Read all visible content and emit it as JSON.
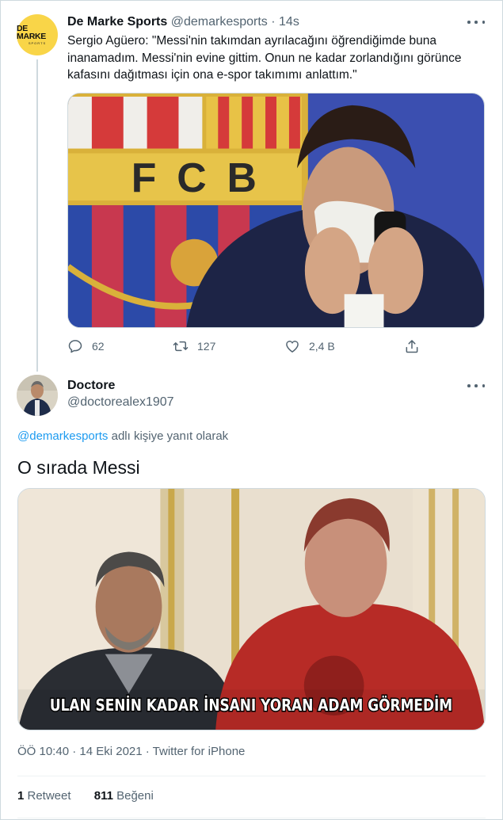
{
  "parent_tweet": {
    "author_name": "De Marke Sports",
    "author_handle": "@demarkesports",
    "separator": "·",
    "time": "14s",
    "avatar_brand": "DE MARKE",
    "avatar_sub": "SPORTS",
    "text": "Sergio Agüero: \"Messi'nin takımdan ayrılacağını öğrendiğimde buna inanamadım. Messi'nin evine gittim. Onun ne kadar zorlandığını görünce kafasını dağıtması için ona e-spor takımımı anlattım.\"",
    "image_text": "FCB",
    "actions": {
      "replies": "62",
      "retweets": "127",
      "likes": "2,4 B"
    }
  },
  "reply_tweet": {
    "author_name": "Doctore",
    "author_handle": "@doctorealex1907",
    "replying_to_handle": "@demarkesports",
    "replying_suffix": " adlı kişiye yanıt olarak",
    "text": "O sırada Messi",
    "image_caption": "ULAN SENİN KADAR İNSANI YORAN ADAM GÖRMEDİM",
    "meta": "ÖÖ 10:40 · 14 Eki 2021 · Twitter for iPhone",
    "retweet_count": "1",
    "retweet_label": " Retweet",
    "like_count": "811",
    "like_label": " Beğeni"
  },
  "colors": {
    "accent": "#1d9bf0",
    "muted": "#536471",
    "text": "#0f1419",
    "avatar_yellow": "#f9d548"
  },
  "icons": [
    "more-icon",
    "reply-icon",
    "retweet-icon",
    "like-icon",
    "share-icon"
  ]
}
